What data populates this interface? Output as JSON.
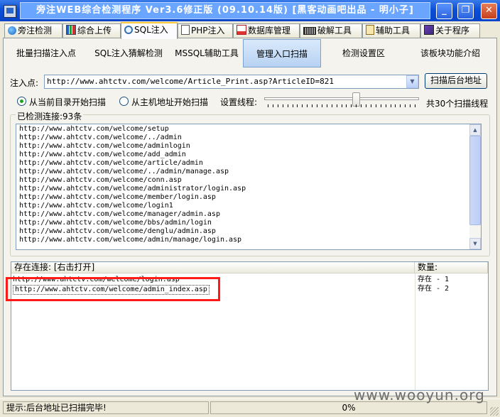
{
  "window": {
    "title": "旁注WEB综合检测程序 Ver3.6修正版 (09.10.14版) [黑客动画吧出品 - 明小子]",
    "minimize_label": "_",
    "restore_label": "❐",
    "close_label": "✕"
  },
  "tabs": [
    {
      "label": "旁注检测",
      "icon": "globe-icon"
    },
    {
      "label": "综合上传",
      "icon": "chart-icon"
    },
    {
      "label": "SQL注入",
      "icon": "search-icon",
      "active": true
    },
    {
      "label": "PHP注入",
      "icon": "document-icon"
    },
    {
      "label": "数据库管理",
      "icon": "database-icon"
    },
    {
      "label": "破解工具",
      "icon": "keyboard-icon"
    },
    {
      "label": "辅助工具",
      "icon": "clipboard-icon"
    },
    {
      "label": "关于程序",
      "icon": "book-icon"
    }
  ],
  "subtabs": [
    {
      "label": "批量扫描注入点"
    },
    {
      "label": "SQL注入猜解检测"
    },
    {
      "label": "MSSQL辅助工具"
    },
    {
      "label": "管理入口扫描",
      "active": true
    },
    {
      "label": "检测设置区"
    },
    {
      "label": "该板块功能介绍"
    }
  ],
  "injection": {
    "label": "注入点:",
    "value": "http://www.ahtctv.com/welcome/Article_Print.asp?ArticleID=821",
    "scan_button": "扫描后台地址"
  },
  "options": {
    "radio_current_dir": "从当前目录开始扫描",
    "radio_host": "从主机地址开始扫描",
    "selected": "radio_current_dir",
    "threads_label": "设置线程:",
    "threads_summary": "共30个扫描线程",
    "threads_level": 0.6
  },
  "checked": {
    "label": "已检测连接:93条",
    "links": [
      "http://www.ahtctv.com/welcome/setup",
      "http://www.ahtctv.com/welcome/../admin",
      "http://www.ahtctv.com/welcome/adminlogin",
      "http://www.ahtctv.com/welcome/add_admin",
      "http://www.ahtctv.com/welcome/article/admin",
      "http://www.ahtctv.com/welcome/../admin/manage.asp",
      "http://www.ahtctv.com/welcome/conn.asp",
      "http://www.ahtctv.com/welcome/administrator/login.asp",
      "http://www.ahtctv.com/welcome/member/login.asp",
      "http://www.ahtctv.com/welcome/login1",
      "http://www.ahtctv.com/welcome/manager/admin.asp",
      "http://www.ahtctv.com/welcome/bbs/admin/login",
      "http://www.ahtctv.com/welcome/denglu/admin.asp",
      "http://www.ahtctv.com/welcome/admin/manage/login.asp"
    ]
  },
  "found": {
    "col_link": "存在连接: [右击打开]",
    "col_count": "数量:",
    "rows": [
      {
        "link": "http://www.ahtctv.com/welcome/login.asp",
        "status": "存在 - 1"
      },
      {
        "link": "http://www.ahtctv.com/welcome/admin_index.asp",
        "status": "存在 - 2"
      }
    ]
  },
  "status": {
    "message": "提示:后台地址已扫描完毕!",
    "progress_text": "0%"
  },
  "watermark": "www.wooyun.org",
  "colors": {
    "titlebar": "#0A4FD8",
    "highlight_box": "#FF1A1A",
    "tab_active_accent": "#FFC83C"
  }
}
